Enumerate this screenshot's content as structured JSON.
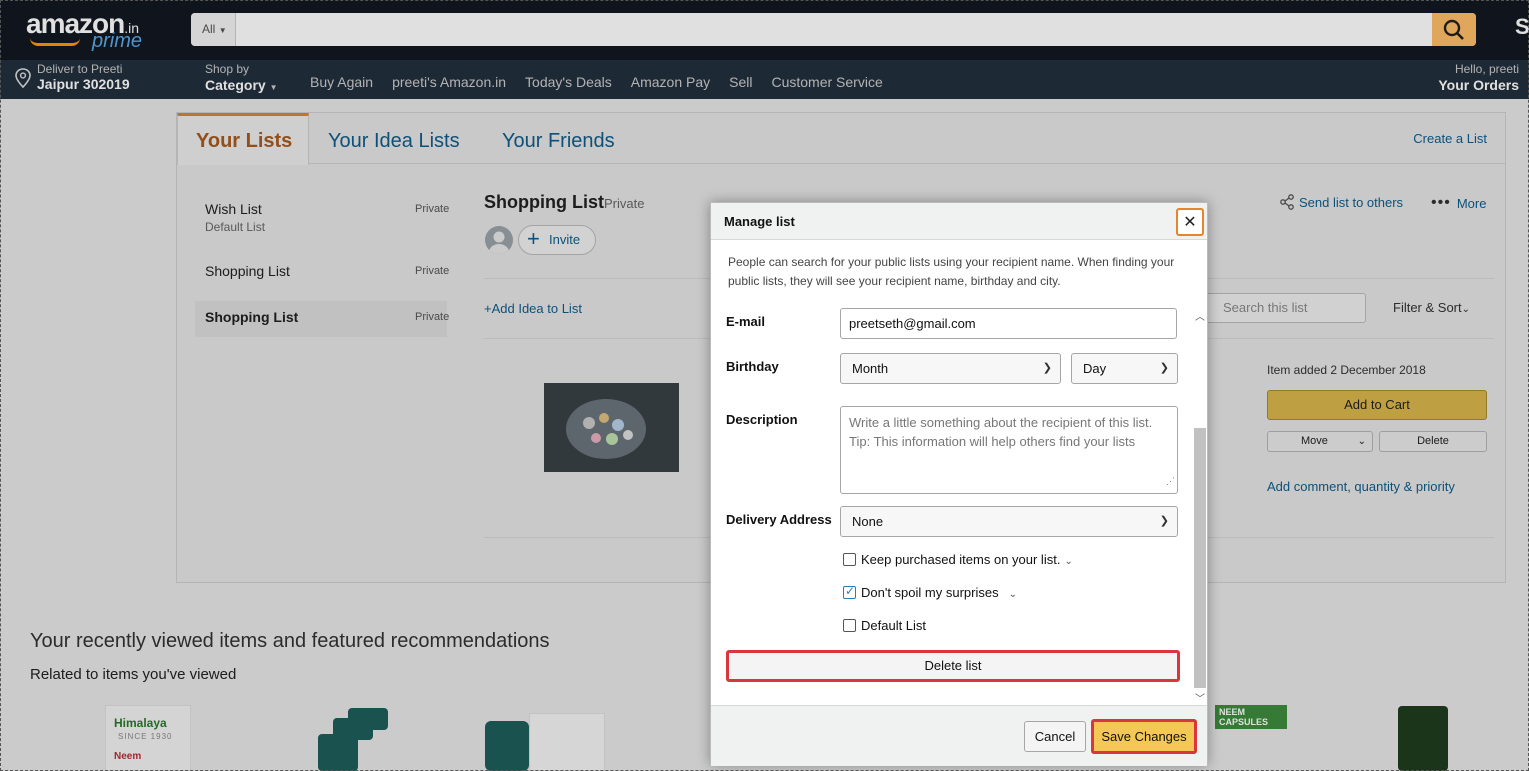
{
  "header": {
    "logo_text": "amazon",
    "logo_suffix": ".in",
    "logo_prime": "prime",
    "search_category": "All",
    "cut_text": "S",
    "deliver_line1": "Deliver to Preeti",
    "deliver_line2": "Jaipur 302019",
    "shopby_line1": "Shop by",
    "shopby_line2": "Category",
    "nav_links": [
      "Buy Again",
      "preeti's Amazon.in",
      "Today's Deals",
      "Amazon Pay",
      "Sell",
      "Customer Service"
    ],
    "hello_line1": "Hello, preeti",
    "hello_line2": "Your Orders"
  },
  "tabs": {
    "your_lists": "Your Lists",
    "idea_lists": "Your Idea Lists",
    "friends": "Your Friends",
    "create_list": "Create a List"
  },
  "sidebar": {
    "items": [
      {
        "name": "Wish List",
        "privacy": "Private",
        "sub": "Default List"
      },
      {
        "name": "Shopping List",
        "privacy": "Private",
        "sub": ""
      },
      {
        "name": "Shopping List",
        "privacy": "Private",
        "sub": ""
      }
    ]
  },
  "list_view": {
    "title": "Shopping List",
    "privacy": "Private",
    "invite": "Invite",
    "add_idea": "+Add Idea to List",
    "send_list": "Send list to others",
    "more": "More",
    "search_placeholder": "Search this list",
    "filter_sort": "Filter & Sort",
    "item_added": "Item added 2 December 2018",
    "add_to_cart": "Add to Cart",
    "move": "Move",
    "delete": "Delete",
    "add_comment": "Add comment, quantity & priority"
  },
  "recommendations": {
    "title": "Your recently viewed items and featured recommendations",
    "subtitle": "Related to items you've viewed",
    "brand_label": "Himalaya",
    "brand_tagline": "SINCE 1930",
    "product_label": "Neem",
    "banner_label": "NEEM CAPSULES"
  },
  "modal": {
    "title": "Manage list",
    "description": "People can search for your public lists using your recipient name. When finding your public lists, they will see your recipient name, birthday and city.",
    "email_label": "E-mail",
    "email_value": "preetseth@gmail.com",
    "birthday_label": "Birthday",
    "month_value": "Month",
    "day_value": "Day",
    "description_label": "Description",
    "description_placeholder": "Write a little something about the recipient of this list. Tip: This information will help others find your lists",
    "delivery_label": "Delivery Address",
    "delivery_value": "None",
    "keep_purchased": "Keep purchased items on your list.",
    "dont_spoil": "Don't spoil my surprises",
    "default_list": "Default List",
    "delete_list": "Delete list",
    "cancel": "Cancel",
    "save": "Save Changes"
  },
  "colors": {
    "header_bg": "#131921",
    "accent": "#ff9900",
    "link": "#0f5c8a",
    "highlight": "#d9363e",
    "save_bg": "#f3c856"
  }
}
